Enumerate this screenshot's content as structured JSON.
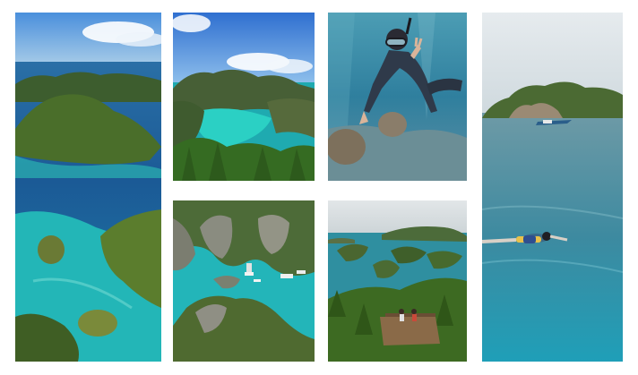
{
  "gallery": {
    "tiles": [
      {
        "scene": "aerial-lagoon-islands"
      },
      {
        "scene": "viewpoint-lagoon"
      },
      {
        "scene": "underwater-snorkeler"
      },
      {
        "scene": "sea-island-boat-snorkeler"
      },
      {
        "scene": "aerial-karst-boats"
      },
      {
        "scene": "viewpoint-platform-bay"
      }
    ]
  },
  "colors": {
    "background": "#ffffff",
    "deep_sea": "#1d5f9a",
    "turquoise": "#2ec4c4",
    "jungle": "#3e6b26",
    "sky": "#4f8fd6"
  }
}
